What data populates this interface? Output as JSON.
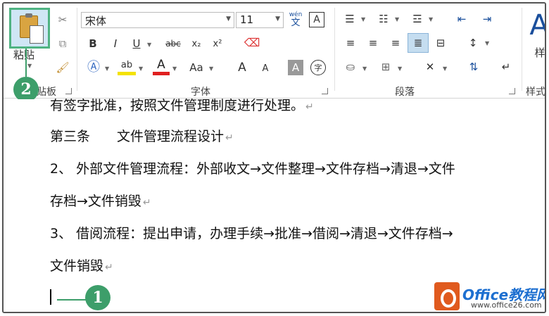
{
  "ribbon": {
    "clipboard": {
      "paste_label": "粘贴",
      "group_label": "剪贴板"
    },
    "font": {
      "font_name": "宋体",
      "font_size": "11",
      "wen_label": "wén",
      "wen_char": "文",
      "a_box": "A",
      "bold": "B",
      "italic": "I",
      "underline": "U",
      "strike": "abc",
      "subscript": "x₂",
      "superscript": "x²",
      "highlight": "ab",
      "font_color": "A",
      "change_case": "Aa",
      "grow": "A",
      "shrink": "A",
      "shade": "A",
      "enclose": "字",
      "group_label": "字体"
    },
    "paragraph": {
      "group_label": "段落"
    },
    "styles": {
      "big_a": "A",
      "style_label": "样",
      "group_label": "样式"
    }
  },
  "markers": {
    "m1": "1",
    "m2": "2"
  },
  "document": {
    "lines": [
      "有签字批准，按照文件管理制度进行处理。",
      "第三条　　文件管理流程设计",
      "2、 外部文件管理流程：外部收文→文件整理→文件存档→清退→文件",
      "存档→文件销毁",
      "3、 借阅流程：提出申请，办理手续→批准→借阅→清退→文件存档→",
      "文件销毁"
    ],
    "para_mark": "↵"
  },
  "watermark": {
    "brand": "Office教程网",
    "url": "www.office26.com"
  },
  "colors": {
    "accent": "#3d9e6a",
    "ribbon_highlight": "#cfe6f5"
  }
}
